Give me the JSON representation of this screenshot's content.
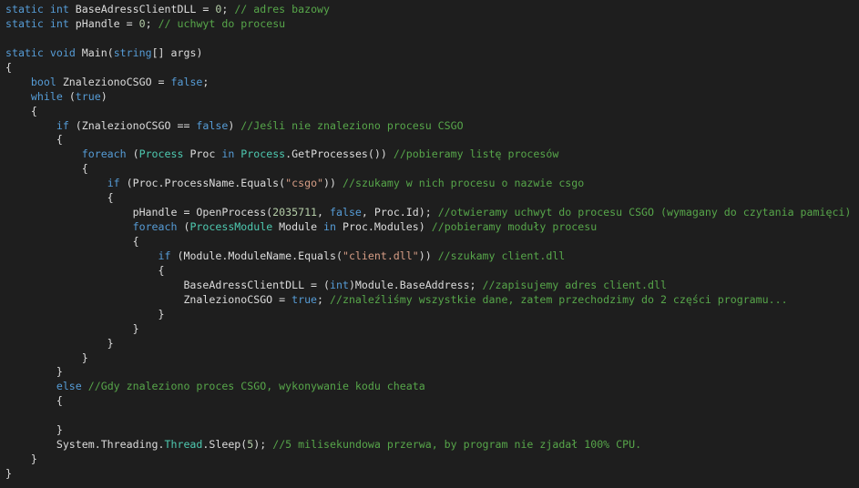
{
  "colors": {
    "background": "#1e1e1e",
    "kw": "#569cd6",
    "typ": "#4ec9b0",
    "cm": "#57a64a",
    "str": "#d69d85",
    "num": "#b5cea8",
    "pl": "#dcdcdc"
  },
  "code_lines": [
    [
      [
        "kw",
        "static "
      ],
      [
        "kw",
        "int "
      ],
      [
        "pl",
        "BaseAdressClientDLL = "
      ],
      [
        "num",
        "0"
      ],
      [
        "pl",
        "; "
      ],
      [
        "cm",
        "// adres bazowy"
      ]
    ],
    [
      [
        "kw",
        "static "
      ],
      [
        "kw",
        "int "
      ],
      [
        "pl",
        "pHandle = "
      ],
      [
        "num",
        "0"
      ],
      [
        "pl",
        "; "
      ],
      [
        "cm",
        "// uchwyt do procesu"
      ]
    ],
    [],
    [
      [
        "kw",
        "static "
      ],
      [
        "kw",
        "void "
      ],
      [
        "pl",
        "Main("
      ],
      [
        "kw",
        "string"
      ],
      [
        "pl",
        "[] args)"
      ]
    ],
    [
      [
        "pl",
        "{"
      ]
    ],
    [
      [
        "pl",
        "    "
      ],
      [
        "kw",
        "bool "
      ],
      [
        "pl",
        "ZnalezionoCSGO = "
      ],
      [
        "kw",
        "false"
      ],
      [
        "pl",
        ";"
      ]
    ],
    [
      [
        "pl",
        "    "
      ],
      [
        "kw",
        "while "
      ],
      [
        "pl",
        "("
      ],
      [
        "kw",
        "true"
      ],
      [
        "pl",
        ")"
      ]
    ],
    [
      [
        "pl",
        "    {"
      ]
    ],
    [
      [
        "pl",
        "        "
      ],
      [
        "kw",
        "if "
      ],
      [
        "pl",
        "(ZnalezionoCSGO == "
      ],
      [
        "kw",
        "false"
      ],
      [
        "pl",
        ") "
      ],
      [
        "cm",
        "//Jeśli nie znaleziono procesu CSGO"
      ]
    ],
    [
      [
        "pl",
        "        {"
      ]
    ],
    [
      [
        "pl",
        "            "
      ],
      [
        "kw",
        "foreach "
      ],
      [
        "pl",
        "("
      ],
      [
        "typ",
        "Process "
      ],
      [
        "pl",
        "Proc "
      ],
      [
        "kw",
        "in "
      ],
      [
        "typ",
        "Process"
      ],
      [
        "pl",
        ".GetProcesses()) "
      ],
      [
        "cm",
        "//pobieramy listę procesów"
      ]
    ],
    [
      [
        "pl",
        "            {"
      ]
    ],
    [
      [
        "pl",
        "                "
      ],
      [
        "kw",
        "if "
      ],
      [
        "pl",
        "(Proc.ProcessName.Equals("
      ],
      [
        "str",
        "\"csgo\""
      ],
      [
        "pl",
        ")) "
      ],
      [
        "cm",
        "//szukamy w nich procesu o nazwie csgo"
      ]
    ],
    [
      [
        "pl",
        "                {"
      ]
    ],
    [
      [
        "pl",
        "                    pHandle = OpenProcess("
      ],
      [
        "num",
        "2035711"
      ],
      [
        "pl",
        ", "
      ],
      [
        "kw",
        "false"
      ],
      [
        "pl",
        ", Proc.Id); "
      ],
      [
        "cm",
        "//otwieramy uchwyt do procesu CSGO (wymagany do czytania pamięci)"
      ]
    ],
    [
      [
        "pl",
        "                    "
      ],
      [
        "kw",
        "foreach "
      ],
      [
        "pl",
        "("
      ],
      [
        "typ",
        "ProcessModule "
      ],
      [
        "pl",
        "Module "
      ],
      [
        "kw",
        "in "
      ],
      [
        "pl",
        "Proc.Modules) "
      ],
      [
        "cm",
        "//pobieramy moduły procesu"
      ]
    ],
    [
      [
        "pl",
        "                    {"
      ]
    ],
    [
      [
        "pl",
        "                        "
      ],
      [
        "kw",
        "if "
      ],
      [
        "pl",
        "(Module.ModuleName.Equals("
      ],
      [
        "str",
        "\"client.dll\""
      ],
      [
        "pl",
        ")) "
      ],
      [
        "cm",
        "//szukamy client.dll"
      ]
    ],
    [
      [
        "pl",
        "                        {"
      ]
    ],
    [
      [
        "pl",
        "                            BaseAdressClientDLL = ("
      ],
      [
        "kw",
        "int"
      ],
      [
        "pl",
        ")Module.BaseAddress; "
      ],
      [
        "cm",
        "//zapisujemy adres client.dll"
      ]
    ],
    [
      [
        "pl",
        "                            ZnalezionoCSGO = "
      ],
      [
        "kw",
        "true"
      ],
      [
        "pl",
        "; "
      ],
      [
        "cm",
        "//znaleźliśmy wszystkie dane, zatem przechodzimy do 2 części programu..."
      ]
    ],
    [
      [
        "pl",
        "                        }"
      ]
    ],
    [
      [
        "pl",
        "                    }"
      ]
    ],
    [
      [
        "pl",
        "                }"
      ]
    ],
    [
      [
        "pl",
        "            }"
      ]
    ],
    [
      [
        "pl",
        "        }"
      ]
    ],
    [
      [
        "pl",
        "        "
      ],
      [
        "kw",
        "else "
      ],
      [
        "cm",
        "//Gdy znaleziono proces CSGO, wykonywanie kodu cheata"
      ]
    ],
    [
      [
        "pl",
        "        {"
      ]
    ],
    [],
    [
      [
        "pl",
        "        }"
      ]
    ],
    [
      [
        "pl",
        "        System.Threading."
      ],
      [
        "typ",
        "Thread"
      ],
      [
        "pl",
        ".Sleep("
      ],
      [
        "num",
        "5"
      ],
      [
        "pl",
        "); "
      ],
      [
        "cm",
        "//5 milisekundowa przerwa, by program nie zjadał 100% CPU."
      ]
    ],
    [
      [
        "pl",
        "    }"
      ]
    ],
    [
      [
        "pl",
        "}"
      ]
    ]
  ]
}
